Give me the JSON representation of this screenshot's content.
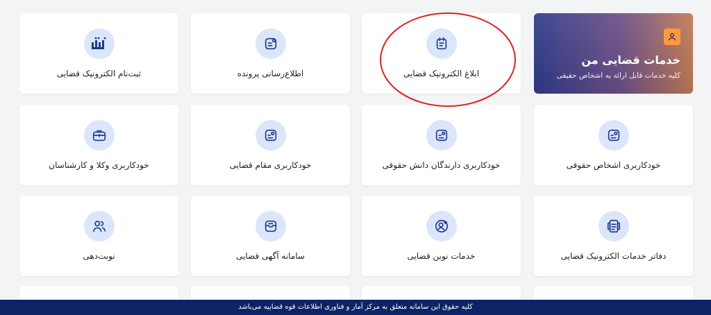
{
  "hero": {
    "title": "خدمات قضایی من",
    "subtitle": "کلیه خدمات قابل ارائه به اشخاص حقیقی",
    "icon": "user-icon",
    "badge_color": "#ff9a3c"
  },
  "services": {
    "row1": [
      {
        "label": "ابلاغ الکترونیک قضایی",
        "icon": "notice-icon"
      },
      {
        "label": "اطلاع‌رسانی پرونده",
        "icon": "case-info-icon"
      },
      {
        "label": "ثبت‌نام الکترونیک قضایی",
        "icon": "sana-logo-icon"
      }
    ],
    "row2": [
      {
        "label": "خودکاربری اشخاص حقوقی",
        "icon": "legal-entity-icon"
      },
      {
        "label": "خودکاربری دارندگان دانش حقوقی",
        "icon": "legal-knowledge-icon"
      },
      {
        "label": "خودکاربری مقام قضایی",
        "icon": "judicial-authority-icon"
      },
      {
        "label": "خودکاربری وکلا و کارشناسان",
        "icon": "briefcase-icon"
      }
    ],
    "row3": [
      {
        "label": "دفاتر خدمات الکترونیک قضایی",
        "icon": "office-icon"
      },
      {
        "label": "خدمات نوین قضایی",
        "icon": "user-add-icon"
      },
      {
        "label": "سامانه آگهی قضایی",
        "icon": "announcement-icon"
      },
      {
        "label": "نوبت‌دهی",
        "icon": "users-icon"
      }
    ]
  },
  "footer": {
    "text": "کلیه حقوق این سامانه متعلق به مرکز آمار و فناوری اطلاعات قوه قضاییه می‌باشد"
  },
  "colors": {
    "icon_bg": "#dbe6fb",
    "icon_stroke": "#1e3a8a",
    "footer_bg": "#0e2366"
  }
}
